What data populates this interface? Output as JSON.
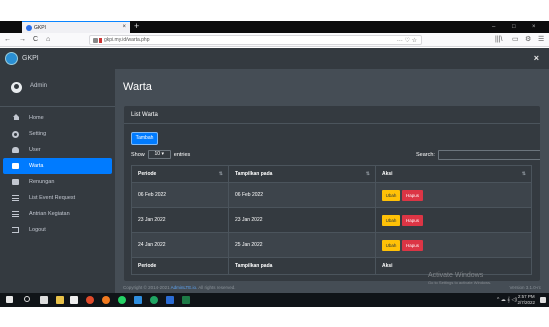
{
  "browser": {
    "tab_title": "GKPI",
    "new_tab_symbol": "+",
    "window_controls": {
      "minimize": "–",
      "maximize": "□",
      "close": "×"
    },
    "tab_close": "×",
    "nav": {
      "back": "←",
      "forward": "→",
      "reload": "C",
      "home": "⌂"
    },
    "url": "gkpi.my.id/warta.php",
    "url_actions": "··· ♡ ☆",
    "right_icons": [
      "|||\\",
      "▭",
      "⚙",
      "☰"
    ]
  },
  "app": {
    "brand": "GKPI",
    "close_symbol": "×",
    "user_name": "Admin",
    "page_title": "Warta",
    "card_title": "List Warta",
    "add_button": "Tambah",
    "show_label": "Show",
    "entries_value": "10",
    "entries_label": "entries",
    "search_label": "Search:"
  },
  "sidebar": {
    "items": [
      {
        "label": "Home",
        "icon": "home-icon",
        "active": false
      },
      {
        "label": "Setting",
        "icon": "gear-icon",
        "active": false
      },
      {
        "label": "User",
        "icon": "user-icon",
        "active": false
      },
      {
        "label": "Warta",
        "icon": "newspaper-icon",
        "active": true
      },
      {
        "label": "Renungan",
        "icon": "book-icon",
        "active": false
      },
      {
        "label": "List Event Request",
        "icon": "list-icon",
        "active": false
      },
      {
        "label": "Antrian Kegiatan",
        "icon": "list-icon",
        "active": false
      },
      {
        "label": "Logout",
        "icon": "logout-icon",
        "active": false
      }
    ]
  },
  "table": {
    "columns": [
      "Periode",
      "Tampilkan pada",
      "Aksi"
    ],
    "rows": [
      {
        "periode": "06 Feb 2022",
        "tampil": "06 Feb 2022"
      },
      {
        "periode": "23 Jan 2022",
        "tampil": "23 Jan 2022"
      },
      {
        "periode": "24 Jan 2022",
        "tampil": "25 Jan 2022"
      }
    ],
    "edit_label": "Ubah",
    "delete_label": "Hapus",
    "sort_symbol": "⇅"
  },
  "footer": {
    "copyright_prefix": "Copyright © 2014-2021 ",
    "copyright_link": "AdminLTE.io.",
    "copyright_suffix": " All rights reserved.",
    "version": "Version 3.1.0-rc"
  },
  "watermark": {
    "line1": "Activate Windows",
    "line2": "Go to Settings to activate Windows."
  },
  "taskbar": {
    "tray": "^ ☁ 𝄞 ◁)",
    "time": "2:57 PM",
    "date": "2/7/2022"
  },
  "colors": {
    "accent": "#007bff",
    "sidebar": "#343a40",
    "content": "#454d55",
    "edit": "#ffc107",
    "delete": "#dc3545"
  }
}
